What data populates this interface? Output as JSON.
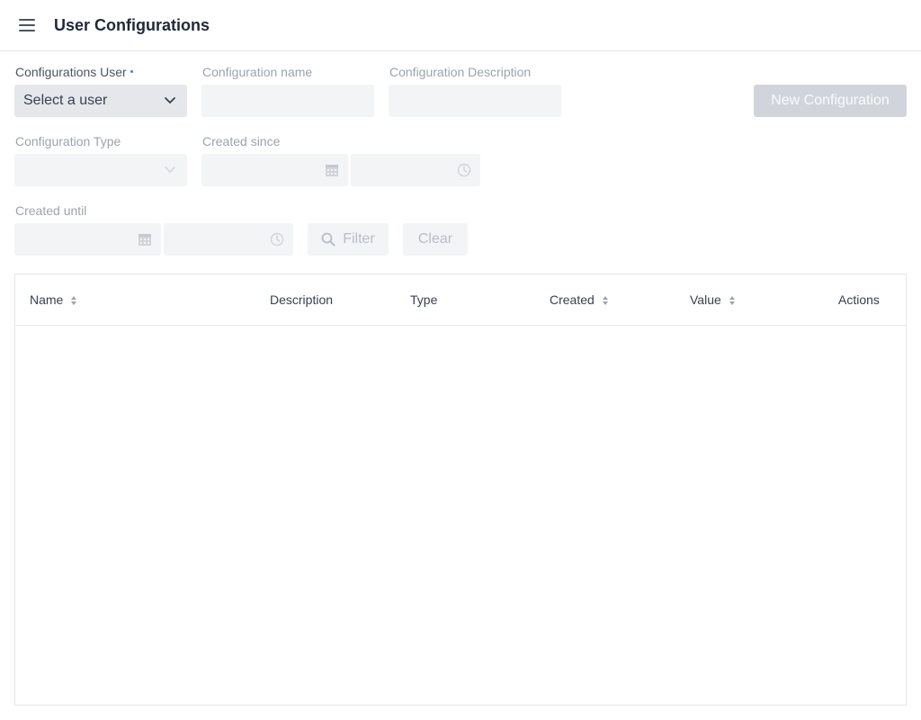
{
  "header": {
    "title": "User Configurations",
    "menu_icon": "hamburger-menu-icon"
  },
  "filters": {
    "user": {
      "label": "Configurations User",
      "value": "Select a user",
      "required": true
    },
    "config_name": {
      "label": "Configuration name",
      "value": ""
    },
    "config_description": {
      "label": "Configuration Description",
      "value": ""
    },
    "config_type": {
      "label": "Configuration Type",
      "value": ""
    },
    "created_since": {
      "label": "Created since",
      "date": "",
      "time": ""
    },
    "created_until": {
      "label": "Created until",
      "date": "",
      "time": ""
    },
    "filter_button": "Filter",
    "clear_button": "Clear"
  },
  "actions": {
    "new_configuration": "New Configuration"
  },
  "table": {
    "columns": [
      "Name",
      "Description",
      "Type",
      "Created",
      "Value",
      "Actions"
    ],
    "rows": []
  },
  "colors": {
    "accent": "#3b82f6",
    "disabled_button": "#d1d5db",
    "field_background": "#f3f4f6"
  }
}
